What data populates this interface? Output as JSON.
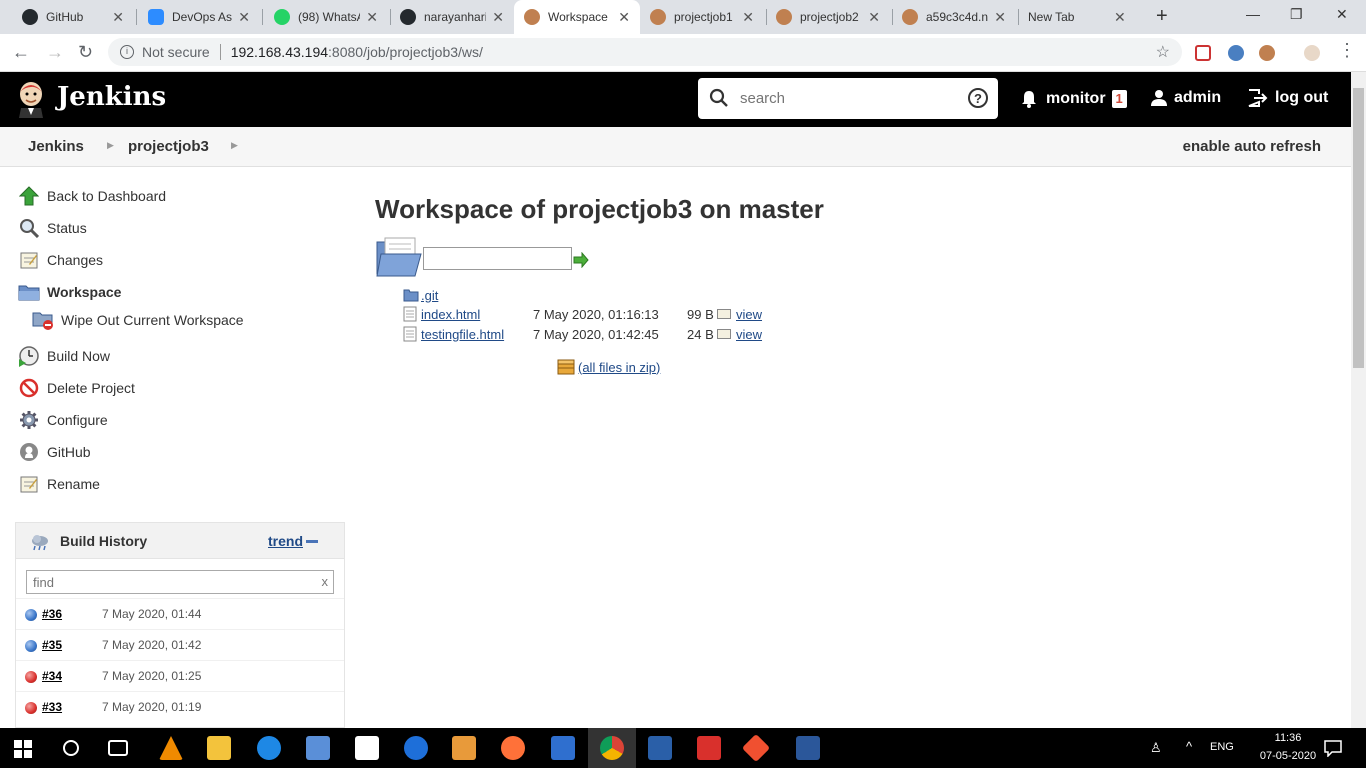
{
  "browser": {
    "tabs": [
      {
        "label": "GitHub",
        "color": "#24292e"
      },
      {
        "label": "DevOps Ass",
        "color": "#2d8cff"
      },
      {
        "label": "(98) WhatsA",
        "color": "#25d366"
      },
      {
        "label": "narayanhari",
        "color": "#24292e"
      },
      {
        "label": "Workspace",
        "color": "#c08050",
        "active": true
      },
      {
        "label": "projectjob1",
        "color": "#c08050"
      },
      {
        "label": "projectjob2",
        "color": "#c08050"
      },
      {
        "label": "a59c3c4d.n",
        "color": "#c08050"
      },
      {
        "label": "New Tab",
        "color": ""
      }
    ],
    "not_secure": "Not secure",
    "url_host": "192.168.43.194",
    "url_rest": ":8080/job/projectjob3/ws/"
  },
  "header": {
    "title": "Jenkins",
    "search_placeholder": "search",
    "monitor_label": "monitor",
    "monitor_count": "1",
    "user": "admin",
    "logout": "log out"
  },
  "breadcrumb": {
    "items": [
      "Jenkins",
      "projectjob3"
    ],
    "auto_refresh": "enable auto refresh"
  },
  "sidebar": {
    "tasks": [
      {
        "label": "Back to Dashboard",
        "icon": "up-arrow-icon"
      },
      {
        "label": "Status",
        "icon": "magnifier-icon"
      },
      {
        "label": "Changes",
        "icon": "notepad-icon"
      },
      {
        "label": "Workspace",
        "icon": "folder-icon",
        "current": true
      },
      {
        "label": "Wipe Out Current Workspace",
        "icon": "folder-delete-icon",
        "sub": true
      },
      {
        "label": "Build Now",
        "icon": "clock-icon"
      },
      {
        "label": "Delete Project",
        "icon": "no-entry-icon"
      },
      {
        "label": "Configure",
        "icon": "gear-icon"
      },
      {
        "label": "GitHub",
        "icon": "github-icon"
      },
      {
        "label": "Rename",
        "icon": "notepad-icon"
      }
    ]
  },
  "build_history": {
    "title": "Build History",
    "trend": "trend",
    "find_placeholder": "find",
    "clear": "x",
    "builds": [
      {
        "number": "#36",
        "date": "7 May 2020, 01:44",
        "status": "success",
        "color": "#3a76c9"
      },
      {
        "number": "#35",
        "date": "7 May 2020, 01:42",
        "status": "success",
        "color": "#3a76c9"
      },
      {
        "number": "#34",
        "date": "7 May 2020, 01:25",
        "status": "failed",
        "color": "#d9302c"
      },
      {
        "number": "#33",
        "date": "7 May 2020, 01:19",
        "status": "failed",
        "color": "#d9302c"
      }
    ]
  },
  "main": {
    "title": "Workspace of projectjob3 on master",
    "files": [
      {
        "name": ".git",
        "type": "folder",
        "date": "",
        "size": "",
        "view": ""
      },
      {
        "name": "index.html",
        "type": "file",
        "date": "7 May 2020, 01:16:13",
        "size": "99 B",
        "view": "view"
      },
      {
        "name": "testingfile.html",
        "type": "file",
        "date": "7 May 2020, 01:42:45",
        "size": "24 B",
        "view": "view"
      }
    ],
    "zip_label": "(all files in zip)"
  },
  "taskbar": {
    "lang": "ENG",
    "time": "11:36",
    "date": "07-05-2020"
  }
}
